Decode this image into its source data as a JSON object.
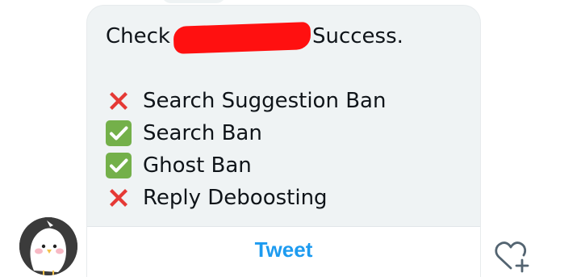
{
  "message": {
    "check_prefix": "Check",
    "check_suffix": "Success.",
    "results": [
      {
        "status": "fail",
        "label": "Search Suggestion Ban"
      },
      {
        "status": "pass",
        "label": "Search Ban"
      },
      {
        "status": "pass",
        "label": "Ghost Ban"
      },
      {
        "status": "fail",
        "label": "Reply Deboosting"
      }
    ]
  },
  "card": {
    "tweet_label": "Tweet"
  },
  "colors": {
    "bubble": "#eff3f4",
    "accent": "#1d9bf0",
    "redaction": "#ff1010",
    "pass": "#74b04a",
    "fail": "#e53935"
  },
  "icons": {
    "fail": "cross-mark-icon",
    "pass": "check-mark-icon",
    "react": "heart-plus-icon"
  }
}
